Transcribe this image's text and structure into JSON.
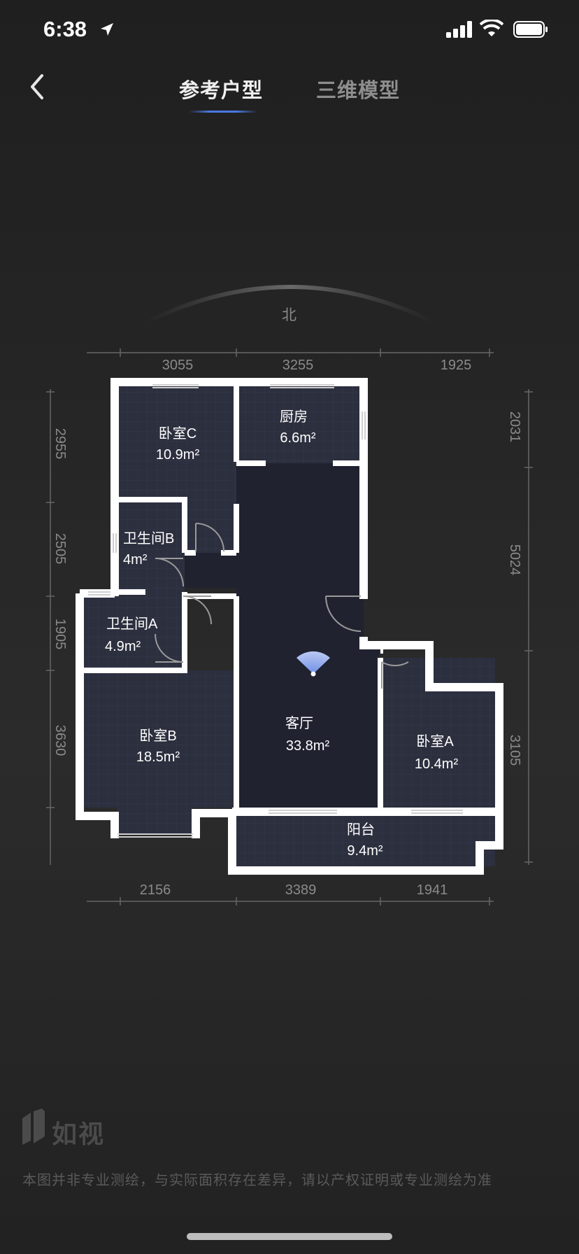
{
  "status_bar": {
    "time": "6:38"
  },
  "nav": {
    "tabs": [
      {
        "label": "参考户型",
        "active": true
      },
      {
        "label": "三维模型",
        "active": false
      }
    ]
  },
  "compass": {
    "label": "北"
  },
  "dimensions": {
    "top": [
      "3055",
      "3255",
      "1925"
    ],
    "bottom": [
      "2156",
      "3389",
      "1941"
    ],
    "left": [
      "2955",
      "2505",
      "1905",
      "3630"
    ],
    "right": [
      "2031",
      "5024",
      "3105"
    ]
  },
  "rooms": [
    {
      "name": "卧室C",
      "area": "10.9",
      "unit": "m²"
    },
    {
      "name": "厨房",
      "area": "6.6",
      "unit": "m²"
    },
    {
      "name": "卫生间B",
      "area": "4",
      "unit": "m²"
    },
    {
      "name": "卫生间A",
      "area": "4.9",
      "unit": "m²"
    },
    {
      "name": "卧室B",
      "area": "18.5",
      "unit": "m²"
    },
    {
      "name": "客厅",
      "area": "33.8",
      "unit": "m²"
    },
    {
      "name": "卧室A",
      "area": "10.4",
      "unit": "m²"
    },
    {
      "name": "阳台",
      "area": "9.4",
      "unit": "m²"
    }
  ],
  "footer": {
    "brand": "如视",
    "disclaimer": "本图并非专业测绘，与实际面积存在差异，请以产权证明或专业测绘为准"
  },
  "colors": {
    "accent": "#4a78e0",
    "wall": "#ffffff",
    "room_fill": "#2c2f3e",
    "living_fill": "#202230"
  }
}
